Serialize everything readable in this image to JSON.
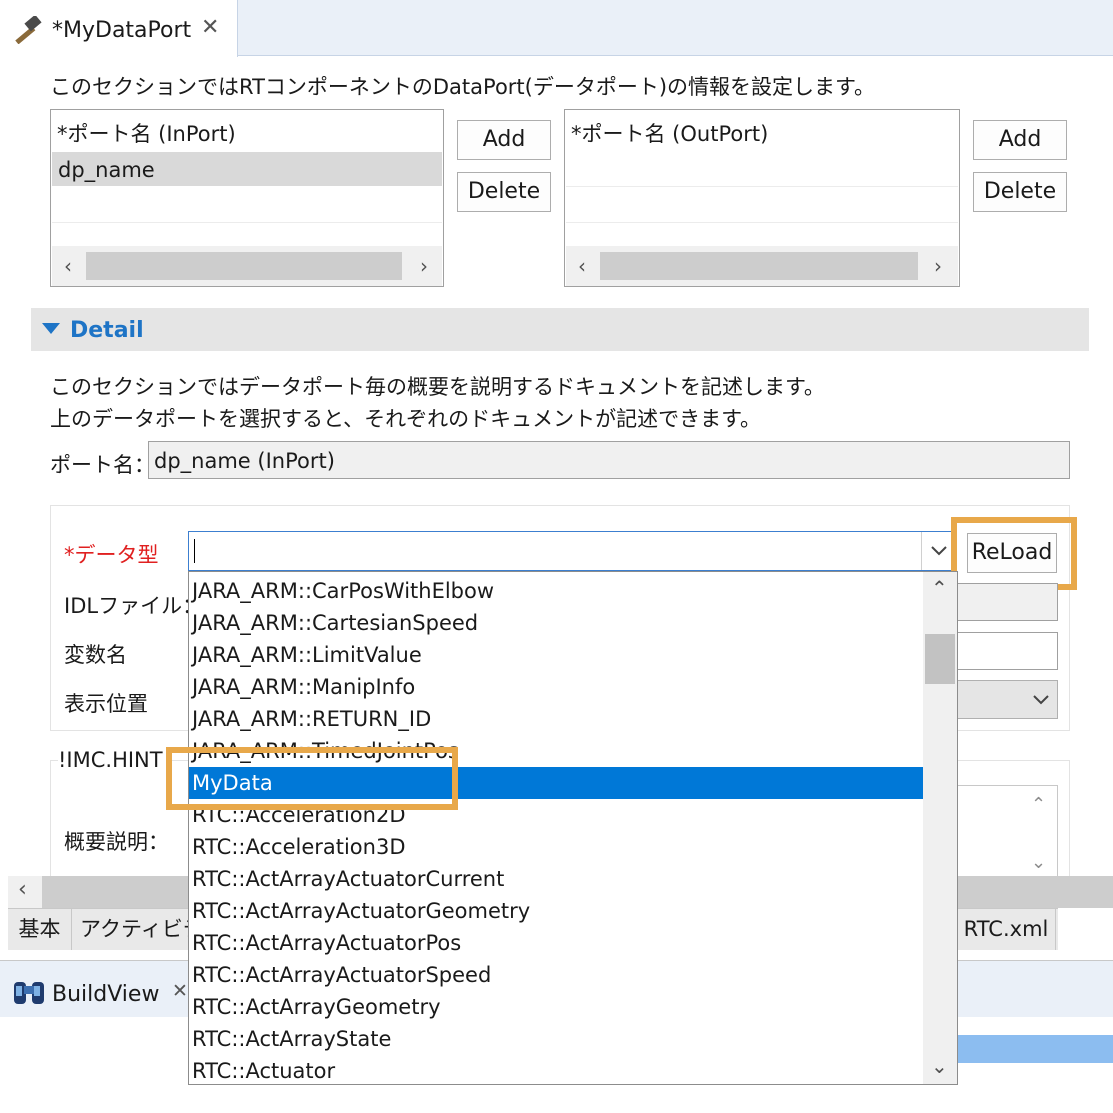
{
  "editor": {
    "tab_title": "*MyDataPort"
  },
  "section": {
    "description": "このセクションではRTコンポーネントのDataPort(データポート)の情報を設定します。"
  },
  "inport": {
    "header": "*ポート名 (InPort)",
    "rows": [
      "dp_name"
    ],
    "add_label": "Add",
    "delete_label": "Delete"
  },
  "outport": {
    "header": "*ポート名 (OutPort)",
    "rows": [],
    "add_label": "Add",
    "delete_label": "Delete"
  },
  "detail": {
    "title": "Detail",
    "desc_line1": "このセクションではデータポート毎の概要を説明するドキュメントを記述します。",
    "desc_line2": "上のデータポートを選択すると、それぞれのドキュメントが記述できます。",
    "port_name_label": "ポート名：",
    "port_name_value": "dp_name (InPort)",
    "data_type_label": "*データ型",
    "data_type_value": "",
    "reload_label": "ReLoad",
    "idl_label": "IDLファイル：",
    "var_label": "変数名",
    "pos_label": "表示位置",
    "hint_label": "!IMC.HINT",
    "summary_label": "概要説明："
  },
  "dropdown": {
    "items": [
      "JARA_ARM::CarPosWithElbow",
      "JARA_ARM::CartesianSpeed",
      "JARA_ARM::LimitValue",
      "JARA_ARM::ManipInfo",
      "JARA_ARM::RETURN_ID",
      "JARA_ARM::TimedJointPos",
      "MyData",
      "RTC::Acceleration2D",
      "RTC::Acceleration3D",
      "RTC::ActArrayActuatorCurrent",
      "RTC::ActArrayActuatorGeometry",
      "RTC::ActArrayActuatorPos",
      "RTC::ActArrayActuatorSpeed",
      "RTC::ActArrayGeometry",
      "RTC::ActArrayState",
      "RTC::Actuator"
    ],
    "selected": "MyData"
  },
  "bottom_tabs": {
    "basic": "基本",
    "activity": "アクティビティ",
    "rtcxml": "RTC.xml"
  },
  "buildview": {
    "title": "BuildView"
  },
  "colors": {
    "selection": "#0078d7",
    "highlight": "#e8a84a",
    "detail_title": "#1e74c6",
    "required_label": "#e02020"
  }
}
